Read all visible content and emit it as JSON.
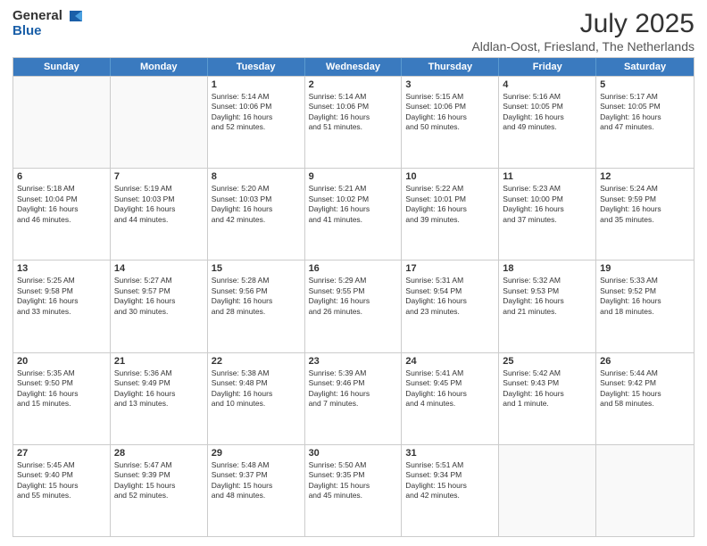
{
  "logo": {
    "general": "General",
    "blue": "Blue"
  },
  "title": "July 2025",
  "location": "Aldlan-Oost, Friesland, The Netherlands",
  "header": {
    "days": [
      "Sunday",
      "Monday",
      "Tuesday",
      "Wednesday",
      "Thursday",
      "Friday",
      "Saturday"
    ]
  },
  "weeks": [
    [
      {
        "day": "",
        "text": ""
      },
      {
        "day": "",
        "text": ""
      },
      {
        "day": "1",
        "text": "Sunrise: 5:14 AM\nSunset: 10:06 PM\nDaylight: 16 hours\nand 52 minutes."
      },
      {
        "day": "2",
        "text": "Sunrise: 5:14 AM\nSunset: 10:06 PM\nDaylight: 16 hours\nand 51 minutes."
      },
      {
        "day": "3",
        "text": "Sunrise: 5:15 AM\nSunset: 10:06 PM\nDaylight: 16 hours\nand 50 minutes."
      },
      {
        "day": "4",
        "text": "Sunrise: 5:16 AM\nSunset: 10:05 PM\nDaylight: 16 hours\nand 49 minutes."
      },
      {
        "day": "5",
        "text": "Sunrise: 5:17 AM\nSunset: 10:05 PM\nDaylight: 16 hours\nand 47 minutes."
      }
    ],
    [
      {
        "day": "6",
        "text": "Sunrise: 5:18 AM\nSunset: 10:04 PM\nDaylight: 16 hours\nand 46 minutes."
      },
      {
        "day": "7",
        "text": "Sunrise: 5:19 AM\nSunset: 10:03 PM\nDaylight: 16 hours\nand 44 minutes."
      },
      {
        "day": "8",
        "text": "Sunrise: 5:20 AM\nSunset: 10:03 PM\nDaylight: 16 hours\nand 42 minutes."
      },
      {
        "day": "9",
        "text": "Sunrise: 5:21 AM\nSunset: 10:02 PM\nDaylight: 16 hours\nand 41 minutes."
      },
      {
        "day": "10",
        "text": "Sunrise: 5:22 AM\nSunset: 10:01 PM\nDaylight: 16 hours\nand 39 minutes."
      },
      {
        "day": "11",
        "text": "Sunrise: 5:23 AM\nSunset: 10:00 PM\nDaylight: 16 hours\nand 37 minutes."
      },
      {
        "day": "12",
        "text": "Sunrise: 5:24 AM\nSunset: 9:59 PM\nDaylight: 16 hours\nand 35 minutes."
      }
    ],
    [
      {
        "day": "13",
        "text": "Sunrise: 5:25 AM\nSunset: 9:58 PM\nDaylight: 16 hours\nand 33 minutes."
      },
      {
        "day": "14",
        "text": "Sunrise: 5:27 AM\nSunset: 9:57 PM\nDaylight: 16 hours\nand 30 minutes."
      },
      {
        "day": "15",
        "text": "Sunrise: 5:28 AM\nSunset: 9:56 PM\nDaylight: 16 hours\nand 28 minutes."
      },
      {
        "day": "16",
        "text": "Sunrise: 5:29 AM\nSunset: 9:55 PM\nDaylight: 16 hours\nand 26 minutes."
      },
      {
        "day": "17",
        "text": "Sunrise: 5:31 AM\nSunset: 9:54 PM\nDaylight: 16 hours\nand 23 minutes."
      },
      {
        "day": "18",
        "text": "Sunrise: 5:32 AM\nSunset: 9:53 PM\nDaylight: 16 hours\nand 21 minutes."
      },
      {
        "day": "19",
        "text": "Sunrise: 5:33 AM\nSunset: 9:52 PM\nDaylight: 16 hours\nand 18 minutes."
      }
    ],
    [
      {
        "day": "20",
        "text": "Sunrise: 5:35 AM\nSunset: 9:50 PM\nDaylight: 16 hours\nand 15 minutes."
      },
      {
        "day": "21",
        "text": "Sunrise: 5:36 AM\nSunset: 9:49 PM\nDaylight: 16 hours\nand 13 minutes."
      },
      {
        "day": "22",
        "text": "Sunrise: 5:38 AM\nSunset: 9:48 PM\nDaylight: 16 hours\nand 10 minutes."
      },
      {
        "day": "23",
        "text": "Sunrise: 5:39 AM\nSunset: 9:46 PM\nDaylight: 16 hours\nand 7 minutes."
      },
      {
        "day": "24",
        "text": "Sunrise: 5:41 AM\nSunset: 9:45 PM\nDaylight: 16 hours\nand 4 minutes."
      },
      {
        "day": "25",
        "text": "Sunrise: 5:42 AM\nSunset: 9:43 PM\nDaylight: 16 hours\nand 1 minute."
      },
      {
        "day": "26",
        "text": "Sunrise: 5:44 AM\nSunset: 9:42 PM\nDaylight: 15 hours\nand 58 minutes."
      }
    ],
    [
      {
        "day": "27",
        "text": "Sunrise: 5:45 AM\nSunset: 9:40 PM\nDaylight: 15 hours\nand 55 minutes."
      },
      {
        "day": "28",
        "text": "Sunrise: 5:47 AM\nSunset: 9:39 PM\nDaylight: 15 hours\nand 52 minutes."
      },
      {
        "day": "29",
        "text": "Sunrise: 5:48 AM\nSunset: 9:37 PM\nDaylight: 15 hours\nand 48 minutes."
      },
      {
        "day": "30",
        "text": "Sunrise: 5:50 AM\nSunset: 9:35 PM\nDaylight: 15 hours\nand 45 minutes."
      },
      {
        "day": "31",
        "text": "Sunrise: 5:51 AM\nSunset: 9:34 PM\nDaylight: 15 hours\nand 42 minutes."
      },
      {
        "day": "",
        "text": ""
      },
      {
        "day": "",
        "text": ""
      }
    ]
  ]
}
